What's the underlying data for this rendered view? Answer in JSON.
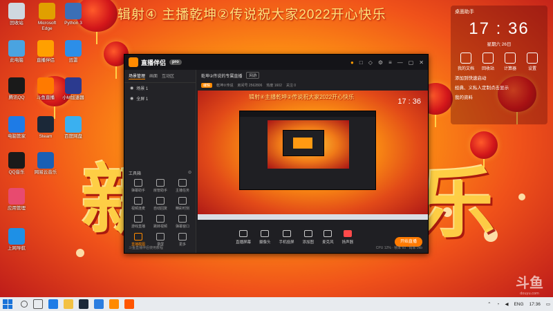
{
  "wallpaper": {
    "banner": "辑射④ 主播乾坤②传说祝大家2022开心快乐",
    "glyph_left": "新",
    "glyph_right": "乐"
  },
  "desktop_icons": [
    {
      "label": "回收站",
      "icon": "recycle-bin-icon",
      "color": "#cfd8e0"
    },
    {
      "label": "Microsoft Edge",
      "icon": "x-app-icon",
      "color": "#e0a000"
    },
    {
      "label": "Python 3",
      "icon": "python-icon",
      "color": "#3b6fb6"
    },
    {
      "label": "此电脑",
      "icon": "computer-icon",
      "color": "#4aa3e0"
    },
    {
      "label": "直播伴侣",
      "icon": "livestream-icon",
      "color": "#ffa000"
    },
    {
      "label": "迅雷",
      "icon": "thunder-icon",
      "color": "#2c8ee8"
    },
    {
      "label": "腾讯QQ",
      "icon": "qq-icon",
      "color": "#1a1a1a"
    },
    {
      "label": "斗鱼直播",
      "icon": "douyu-icon",
      "color": "#ff7a00"
    },
    {
      "label": "小M加速器",
      "icon": "m-app-icon",
      "color": "#2b3a8f"
    },
    {
      "label": "电脑管家",
      "icon": "shield-icon",
      "color": "#1e7be6"
    },
    {
      "label": "Steam",
      "icon": "steam-icon",
      "color": "#1b2838"
    },
    {
      "label": "百度网盘",
      "icon": "cloud-icon",
      "color": "#3ab0f0"
    },
    {
      "label": "QQ音乐",
      "icon": "qq-music-icon",
      "color": "#1a1a1a"
    },
    {
      "label": "网易云音乐",
      "icon": "music-icon",
      "color": "#1a5fb4"
    },
    {
      "label": "应用管理",
      "icon": "app-manager-icon",
      "color": "#e84a6f"
    },
    {
      "label": "上网导航",
      "icon": "ie-icon",
      "color": "#1e90e6"
    }
  ],
  "clock_widget": {
    "title": "桌面助手",
    "time": "17 : 36",
    "date": "星期六 26日",
    "shortcuts": [
      "我的文档",
      "回收站",
      "计算器",
      "设置"
    ],
    "links": [
      "添加到快速启动",
      "经典、义私人定制点击显示",
      "我的资料"
    ]
  },
  "app": {
    "name": "直播伴侣",
    "badge": "pro",
    "sidebar_tabs": [
      "场景管理",
      "画面",
      "互动区"
    ],
    "scenes": [
      "场景 1",
      "全屏 1"
    ],
    "tools_header": "工具箱",
    "tools": [
      "弹幕助手",
      "房管助手",
      "主播任务",
      "视频连麦",
      "自动回复",
      "精彩时刻",
      "游戏直播",
      "跳转视频",
      "弹幕窗口",
      "直播截图",
      "录屏",
      "更多"
    ],
    "sidebar_footer": "斗鱼直播伴侣使用教程",
    "room_title": "乾坤②传说的专属直播",
    "room_tag": "网游",
    "edit_label": "编辑",
    "room_stats": [
      "乾坤②传说",
      "房间号 2562806",
      "热度 1602",
      "关注 0"
    ],
    "controls": [
      "直播屏幕",
      "摄像头",
      "手机投屏",
      "添加图",
      "麦克风",
      "扬声器"
    ],
    "go_live": "开始直播",
    "status": "CPU 12% · 帧率 60 · 码率 0kb"
  },
  "preview": {
    "banner": "辑射④主播乾坤②传说祝大家2022开心快乐",
    "clock": "17 : 36"
  },
  "taskbar": {
    "lang": "ENG",
    "time": "17:36"
  },
  "watermark": {
    "logo": "斗鱼",
    "url": "douyu.com"
  }
}
